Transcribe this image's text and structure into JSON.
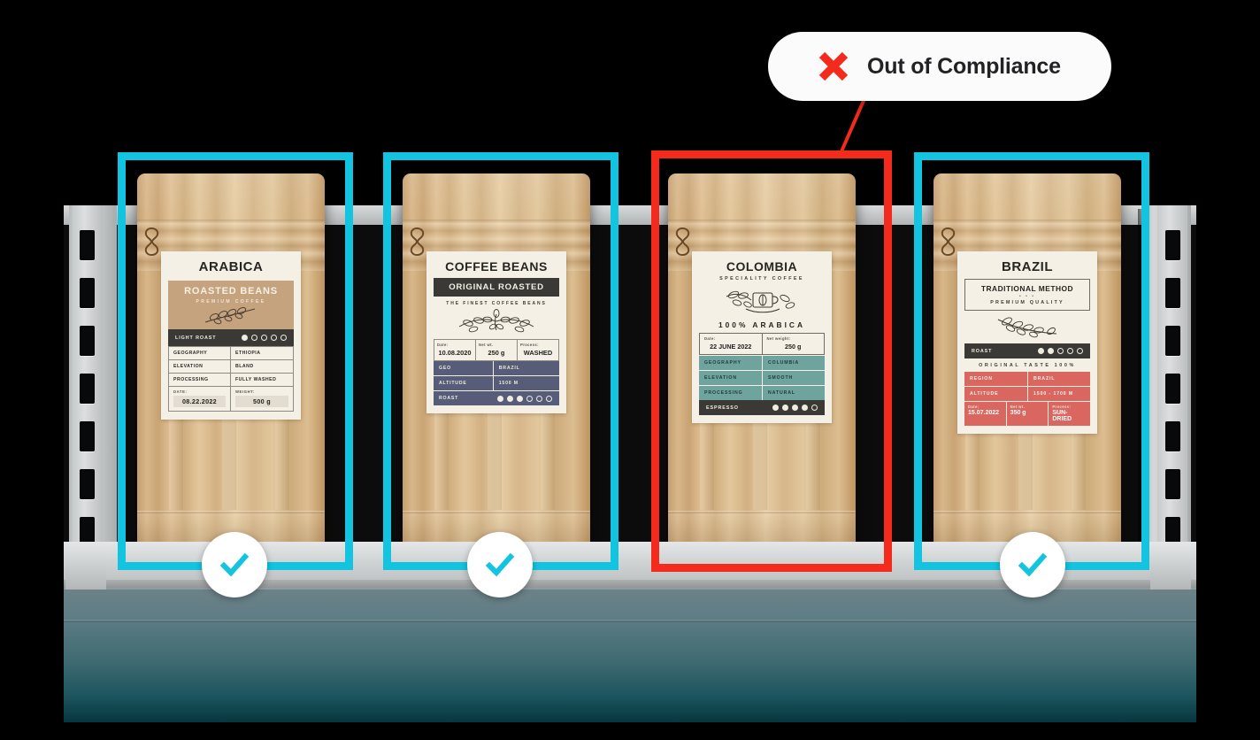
{
  "badge": {
    "label": "Out of Compliance",
    "icon": "x-mark-icon",
    "color": "#F42B1C"
  },
  "colors": {
    "compliant_box": "#12C4E0",
    "noncompliant_box": "#F42B1C",
    "check_mark": "#12C4E0",
    "shelf_gray": "#C6C9CA",
    "shelf_panel_top": "#6E8288",
    "shelf_panel_bottom": "#07363E",
    "kraft_bag": "#D8B789"
  },
  "products": [
    {
      "status": "compliant",
      "status_icon": "check-mark-icon",
      "label": {
        "title": "ARABICA",
        "band_title": "ROASTED BEANS",
        "band_subtitle": "PREMIUM COFFEE",
        "roast_name": "LIGHT ROAST",
        "roast_filled": 1,
        "roast_total": 5,
        "rows": [
          {
            "key": "GEOGRAPHY",
            "value": "ETHIOPIA"
          },
          {
            "key": "ELEVATION",
            "value": "BLAND"
          },
          {
            "key": "PROCESSING",
            "value": "FULLY WASHED"
          }
        ],
        "meta": [
          {
            "key": "DATE:",
            "value": "08.22.2022"
          },
          {
            "key": "WEIGHT:",
            "value": "500 g"
          }
        ]
      }
    },
    {
      "status": "compliant",
      "status_icon": "check-mark-icon",
      "label": {
        "title": "COFFEE  BEANS",
        "bar_title": "ORIGINAL ROASTED",
        "fine_print": "THE FINEST COFFEE BEANS",
        "top_cells": [
          {
            "key": "Date:",
            "value": "10.08.2020"
          },
          {
            "key": "Net wt.",
            "value": "250 g"
          },
          {
            "key": "Process:",
            "value": "WASHED"
          }
        ],
        "rows": [
          {
            "key": "GEO",
            "value": "BRAZIL"
          },
          {
            "key": "ALTITUDE",
            "value": "1500 M"
          }
        ],
        "roast_name": "ROAST",
        "roast_filled": 3,
        "roast_total": 6
      }
    },
    {
      "status": "noncompliant",
      "status_icon": "x-mark-icon",
      "label": {
        "title": "COLOMBIA",
        "subtitle": "SPECIALITY COFFEE",
        "arabica_line": "100%  ARABICA",
        "top_cells": [
          {
            "key": "Date:",
            "value": "22 JUNE 2022"
          },
          {
            "key": "Net weight:",
            "value": "250 g"
          }
        ],
        "rows": [
          {
            "key": "GEOGRAPHY",
            "value": "COLUMBIA"
          },
          {
            "key": "ELEVATION",
            "value": "SMOOTH"
          },
          {
            "key": "PROCESSING",
            "value": "NATURAL"
          }
        ],
        "roast_name": "ESPRESSO",
        "roast_filled": 4,
        "roast_total": 5
      }
    },
    {
      "status": "compliant",
      "status_icon": "check-mark-icon",
      "label": {
        "title": "BRAZIL",
        "box_title": "TRADITIONAL METHOD",
        "box_dots": "• • •",
        "box_subtitle": "PREMIUM QUALITY",
        "roast_name": "ROAST",
        "roast_filled": 2,
        "roast_total": 5,
        "taste_line": "ORIGINAL  TASTE  100%",
        "rows": [
          {
            "key": "REGION",
            "value": "BRAZIL"
          },
          {
            "key": "ALTITUDE",
            "value": "1500 - 1700 M"
          }
        ],
        "bottom_cells": [
          {
            "key": "Date:",
            "value": "15.07.2022"
          },
          {
            "key": "Net wt.",
            "value": "350 g"
          },
          {
            "key": "Process:",
            "value": "SUN-DRIED"
          }
        ]
      }
    }
  ]
}
